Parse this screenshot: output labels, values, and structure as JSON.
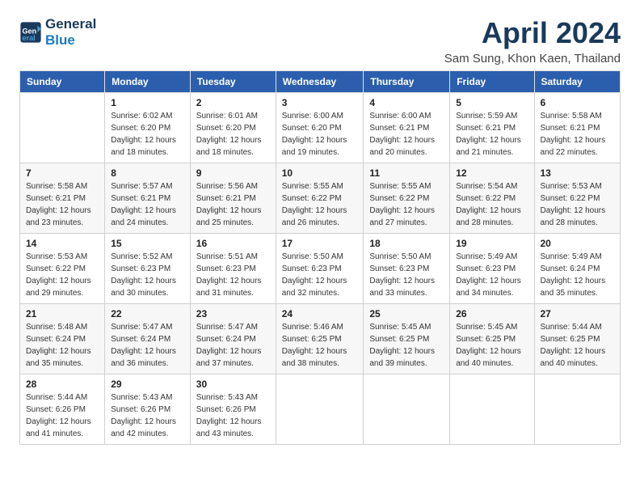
{
  "header": {
    "logo_line1": "General",
    "logo_line2": "Blue",
    "month": "April 2024",
    "location": "Sam Sung, Khon Kaen, Thailand"
  },
  "days_of_week": [
    "Sunday",
    "Monday",
    "Tuesday",
    "Wednesday",
    "Thursday",
    "Friday",
    "Saturday"
  ],
  "weeks": [
    [
      {
        "day": "",
        "info": ""
      },
      {
        "day": "1",
        "info": "Sunrise: 6:02 AM\nSunset: 6:20 PM\nDaylight: 12 hours\nand 18 minutes."
      },
      {
        "day": "2",
        "info": "Sunrise: 6:01 AM\nSunset: 6:20 PM\nDaylight: 12 hours\nand 18 minutes."
      },
      {
        "day": "3",
        "info": "Sunrise: 6:00 AM\nSunset: 6:20 PM\nDaylight: 12 hours\nand 19 minutes."
      },
      {
        "day": "4",
        "info": "Sunrise: 6:00 AM\nSunset: 6:21 PM\nDaylight: 12 hours\nand 20 minutes."
      },
      {
        "day": "5",
        "info": "Sunrise: 5:59 AM\nSunset: 6:21 PM\nDaylight: 12 hours\nand 21 minutes."
      },
      {
        "day": "6",
        "info": "Sunrise: 5:58 AM\nSunset: 6:21 PM\nDaylight: 12 hours\nand 22 minutes."
      }
    ],
    [
      {
        "day": "7",
        "info": "Sunrise: 5:58 AM\nSunset: 6:21 PM\nDaylight: 12 hours\nand 23 minutes."
      },
      {
        "day": "8",
        "info": "Sunrise: 5:57 AM\nSunset: 6:21 PM\nDaylight: 12 hours\nand 24 minutes."
      },
      {
        "day": "9",
        "info": "Sunrise: 5:56 AM\nSunset: 6:21 PM\nDaylight: 12 hours\nand 25 minutes."
      },
      {
        "day": "10",
        "info": "Sunrise: 5:55 AM\nSunset: 6:22 PM\nDaylight: 12 hours\nand 26 minutes."
      },
      {
        "day": "11",
        "info": "Sunrise: 5:55 AM\nSunset: 6:22 PM\nDaylight: 12 hours\nand 27 minutes."
      },
      {
        "day": "12",
        "info": "Sunrise: 5:54 AM\nSunset: 6:22 PM\nDaylight: 12 hours\nand 28 minutes."
      },
      {
        "day": "13",
        "info": "Sunrise: 5:53 AM\nSunset: 6:22 PM\nDaylight: 12 hours\nand 28 minutes."
      }
    ],
    [
      {
        "day": "14",
        "info": "Sunrise: 5:53 AM\nSunset: 6:22 PM\nDaylight: 12 hours\nand 29 minutes."
      },
      {
        "day": "15",
        "info": "Sunrise: 5:52 AM\nSunset: 6:23 PM\nDaylight: 12 hours\nand 30 minutes."
      },
      {
        "day": "16",
        "info": "Sunrise: 5:51 AM\nSunset: 6:23 PM\nDaylight: 12 hours\nand 31 minutes."
      },
      {
        "day": "17",
        "info": "Sunrise: 5:50 AM\nSunset: 6:23 PM\nDaylight: 12 hours\nand 32 minutes."
      },
      {
        "day": "18",
        "info": "Sunrise: 5:50 AM\nSunset: 6:23 PM\nDaylight: 12 hours\nand 33 minutes."
      },
      {
        "day": "19",
        "info": "Sunrise: 5:49 AM\nSunset: 6:23 PM\nDaylight: 12 hours\nand 34 minutes."
      },
      {
        "day": "20",
        "info": "Sunrise: 5:49 AM\nSunset: 6:24 PM\nDaylight: 12 hours\nand 35 minutes."
      }
    ],
    [
      {
        "day": "21",
        "info": "Sunrise: 5:48 AM\nSunset: 6:24 PM\nDaylight: 12 hours\nand 35 minutes."
      },
      {
        "day": "22",
        "info": "Sunrise: 5:47 AM\nSunset: 6:24 PM\nDaylight: 12 hours\nand 36 minutes."
      },
      {
        "day": "23",
        "info": "Sunrise: 5:47 AM\nSunset: 6:24 PM\nDaylight: 12 hours\nand 37 minutes."
      },
      {
        "day": "24",
        "info": "Sunrise: 5:46 AM\nSunset: 6:25 PM\nDaylight: 12 hours\nand 38 minutes."
      },
      {
        "day": "25",
        "info": "Sunrise: 5:45 AM\nSunset: 6:25 PM\nDaylight: 12 hours\nand 39 minutes."
      },
      {
        "day": "26",
        "info": "Sunrise: 5:45 AM\nSunset: 6:25 PM\nDaylight: 12 hours\nand 40 minutes."
      },
      {
        "day": "27",
        "info": "Sunrise: 5:44 AM\nSunset: 6:25 PM\nDaylight: 12 hours\nand 40 minutes."
      }
    ],
    [
      {
        "day": "28",
        "info": "Sunrise: 5:44 AM\nSunset: 6:26 PM\nDaylight: 12 hours\nand 41 minutes."
      },
      {
        "day": "29",
        "info": "Sunrise: 5:43 AM\nSunset: 6:26 PM\nDaylight: 12 hours\nand 42 minutes."
      },
      {
        "day": "30",
        "info": "Sunrise: 5:43 AM\nSunset: 6:26 PM\nDaylight: 12 hours\nand 43 minutes."
      },
      {
        "day": "",
        "info": ""
      },
      {
        "day": "",
        "info": ""
      },
      {
        "day": "",
        "info": ""
      },
      {
        "day": "",
        "info": ""
      }
    ]
  ]
}
